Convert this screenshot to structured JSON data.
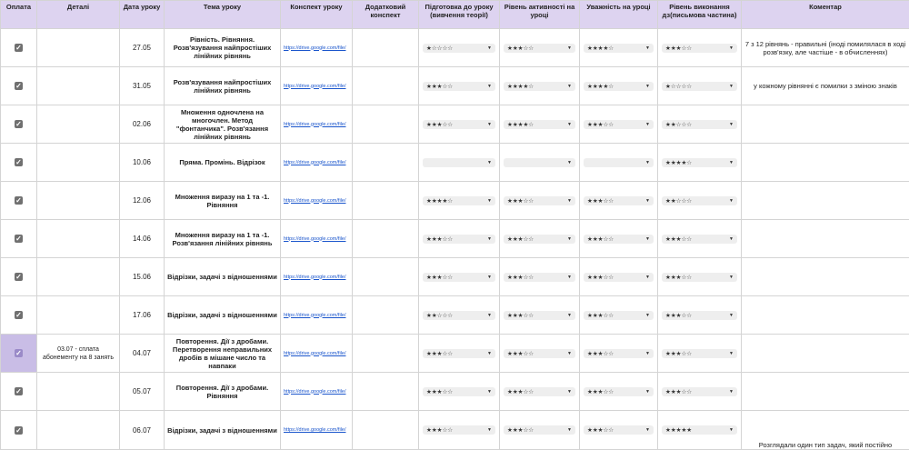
{
  "headers": {
    "payment": "Оплата",
    "details": "Деталі",
    "date": "Дата уроку",
    "topic": "Тема уроку",
    "notes": "Конспект уроку",
    "extra_notes": "Додатковий конспект",
    "prep": "Підготовка до уроку (вивчення теорії)",
    "activity": "Рівень активності на уроці",
    "attention": "Уважність на уроці",
    "homework": "Рівень виконання дз(письмова частина)",
    "comment": "Коментар"
  },
  "rows": [
    {
      "paid": true,
      "highlight": false,
      "details": "",
      "date": "27.05",
      "topic": "Рівність. Рівняння. Розв'язування найпростіших лінійних рівнянь",
      "link": "https://drive.google.com/file/",
      "prep": "★☆☆☆☆",
      "activity": "★★★☆☆",
      "attention": "★★★★☆",
      "homework": "★★★☆☆",
      "comment": "7 з 12 рівнянь - правильні (іноді помилялася в ході розв'язку, але частіше - в обчисленнях)"
    },
    {
      "paid": true,
      "highlight": false,
      "details": "",
      "date": "31.05",
      "topic": "Розв'язування найпростіших лінійних рівнянь",
      "link": "https://drive.google.com/file/",
      "prep": "★★★☆☆",
      "activity": "★★★★☆",
      "attention": "★★★★☆",
      "homework": "★☆☆☆☆",
      "comment": "у кожному рівнянні є помилки з зміною знаків"
    },
    {
      "paid": true,
      "highlight": false,
      "details": "",
      "date": "02.06",
      "topic": "Множення одночлена на многочлен. Метод \"фонтанчика\". Розв'язання лінійних рівнянь",
      "link": "https://drive.google.com/file/",
      "prep": "★★★☆☆",
      "activity": "★★★★☆",
      "attention": "★★★☆☆",
      "homework": "★★☆☆☆",
      "comment": ""
    },
    {
      "paid": true,
      "highlight": false,
      "details": "",
      "date": "10.06",
      "topic": "Пряма. Промінь. Відрізок",
      "link": "https://drive.google.com/file/",
      "prep": "",
      "activity": "",
      "attention": "",
      "homework": "★★★★☆",
      "comment": ""
    },
    {
      "paid": true,
      "highlight": false,
      "details": "",
      "date": "12.06",
      "topic": "Множення виразу на 1 та -1. Рівняння",
      "link": "https://drive.google.com/file/",
      "prep": "★★★★☆",
      "activity": "★★★☆☆",
      "attention": "★★★☆☆",
      "homework": "★★☆☆☆",
      "comment": ""
    },
    {
      "paid": true,
      "highlight": false,
      "details": "",
      "date": "14.06",
      "topic": "Множення виразу на 1 та -1. Розв'язання лінійних рівнянь",
      "link": "https://drive.google.com/file/",
      "prep": "★★★☆☆",
      "activity": "★★★☆☆",
      "attention": "★★★☆☆",
      "homework": "★★★☆☆",
      "comment": ""
    },
    {
      "paid": true,
      "highlight": false,
      "details": "",
      "date": "15.06",
      "topic": "Відрізки, задачі з відношеннями",
      "link": "https://drive.google.com/file/",
      "prep": "★★★☆☆",
      "activity": "★★★☆☆",
      "attention": "★★★☆☆",
      "homework": "★★★☆☆",
      "comment": ""
    },
    {
      "paid": true,
      "highlight": false,
      "details": "",
      "date": "17.06",
      "topic": "Відрізки, задачі з відношеннями",
      "link": "https://drive.google.com/file/",
      "prep": "★★☆☆☆",
      "activity": "★★★☆☆",
      "attention": "★★★☆☆",
      "homework": "★★★☆☆",
      "comment": ""
    },
    {
      "paid": true,
      "highlight": true,
      "details": "03.07 - сплата абонементу на 8 занять",
      "date": "04.07",
      "topic": "Повторення. Дії з дробами. Перетворення неправильних дробів в мішане число та навпаки",
      "link": "https://drive.google.com/file/",
      "prep": "★★★☆☆",
      "activity": "★★★☆☆",
      "attention": "★★★☆☆",
      "homework": "★★★☆☆",
      "comment": ""
    },
    {
      "paid": true,
      "highlight": false,
      "details": "",
      "date": "05.07",
      "topic": "Повторення. Дії з дробами. Рівняння",
      "link": "https://drive.google.com/file/",
      "prep": "★★★☆☆",
      "activity": "★★★☆☆",
      "attention": "★★★☆☆",
      "homework": "★★★☆☆",
      "comment": ""
    },
    {
      "paid": true,
      "highlight": false,
      "details": "",
      "date": "06.07",
      "topic": "Відрізки, задачі з відношеннями",
      "link": "https://drive.google.com/file/",
      "prep": "★★★☆☆",
      "activity": "★★★☆☆",
      "attention": "★★★☆☆",
      "homework": "★★★★★",
      "comment": "Розглядали один тип задач, який постійно"
    }
  ]
}
